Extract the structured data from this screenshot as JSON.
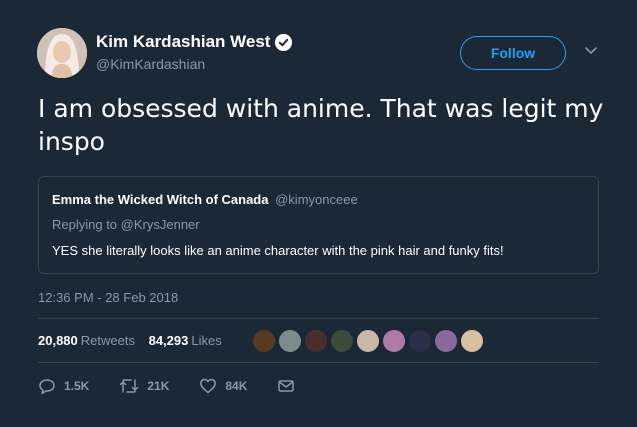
{
  "author": {
    "display_name": "Kim Kardashian West",
    "handle": "@KimKardashian",
    "verified": true
  },
  "follow_label": "Follow",
  "tweet_text": "I am obsessed with anime. That was legit my inspo",
  "quoted_tweet": {
    "display_name": "Emma the Wicked Witch of Canada",
    "handle": "@kimyonceee",
    "replying_prefix": "Replying to",
    "replying_to": "@KrysJenner",
    "text": "YES she literally looks like an anime character with the pink hair and funky fits!"
  },
  "timestamp": "12:36 PM - 28 Feb 2018",
  "stats": {
    "retweets": "20,880",
    "retweets_label": "Retweets",
    "likes": "84,293",
    "likes_label": "Likes"
  },
  "liker_avatars": [
    {
      "name": "liker-avatar-1",
      "color": "#5a3a22"
    },
    {
      "name": "liker-avatar-2",
      "color": "#7d8c8a"
    },
    {
      "name": "liker-avatar-3",
      "color": "#4a2e2e"
    },
    {
      "name": "liker-avatar-4",
      "color": "#3c4a3a"
    },
    {
      "name": "liker-avatar-5",
      "color": "#c9b8a8"
    },
    {
      "name": "liker-avatar-6",
      "color": "#b07aa8"
    },
    {
      "name": "liker-avatar-7",
      "color": "#2c2f4a"
    },
    {
      "name": "liker-avatar-8",
      "color": "#8a6a9a"
    },
    {
      "name": "liker-avatar-9",
      "color": "#d8c0a0"
    }
  ],
  "actions": {
    "reply_count": "1.5K",
    "retweet_count": "21K",
    "like_count": "84K"
  },
  "colors": {
    "background": "#1b2836",
    "accent": "#1da1f2",
    "muted": "#8899a6",
    "border": "#38444d"
  }
}
